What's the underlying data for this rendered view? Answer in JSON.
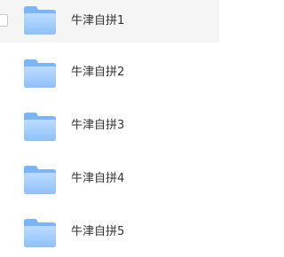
{
  "files": [
    {
      "name": "牛津自拼1",
      "icon": "folder-icon",
      "hovered": true
    },
    {
      "name": "牛津自拼2",
      "icon": "folder-icon",
      "hovered": false
    },
    {
      "name": "牛津自拼3",
      "icon": "folder-icon",
      "hovered": false
    },
    {
      "name": "牛津自拼4",
      "icon": "folder-icon",
      "hovered": false
    },
    {
      "name": "牛津自拼5",
      "icon": "folder-icon",
      "hovered": false
    }
  ],
  "colors": {
    "folder_back": "#7eb5f4",
    "folder_front_top": "#b8d9ff",
    "folder_front_bottom": "#8fc0fa",
    "hover_bg": "#f5f5f5",
    "text": "#333333"
  }
}
